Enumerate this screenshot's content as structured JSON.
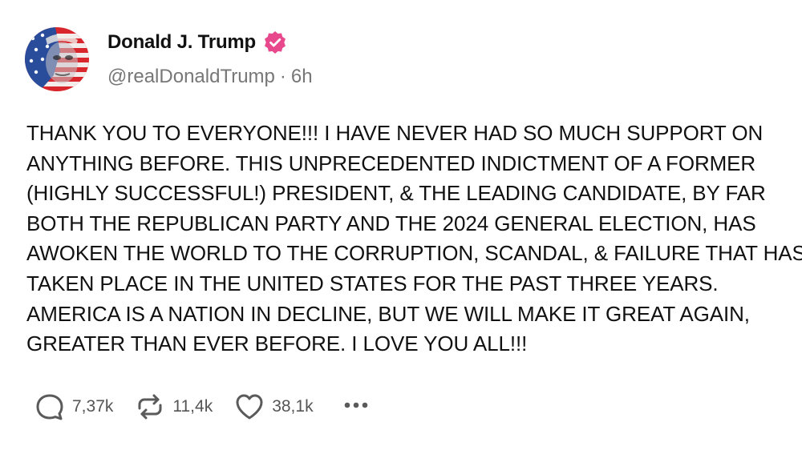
{
  "post": {
    "author": {
      "display_name": "Donald J. Trump",
      "verified": true,
      "handle": "@realDonaldTrump",
      "separator": "·",
      "time": "6h"
    },
    "text": "THANK YOU TO EVERYONE!!! I HAVE NEVER HAD SO MUCH SUPPORT ON\nANYTHING BEFORE. THIS UNPRECEDENTED INDICTMENT OF A FORMER\n(HIGHLY SUCCESSFUL!) PRESIDENT, & THE LEADING CANDIDATE, BY FAR\nBOTH THE REPUBLICAN PARTY AND THE 2024 GENERAL ELECTION, HAS\nAWOKEN THE WORLD TO THE CORRUPTION, SCANDAL, & FAILURE THAT HAS\nTAKEN PLACE IN THE UNITED STATES FOR THE PAST THREE YEARS.\nAMERICA IS A NATION IN DECLINE, BUT WE WILL MAKE IT GREAT AGAIN,\nGREATER THAN EVER BEFORE. I LOVE YOU ALL!!!",
    "actions": {
      "replies": "7,37k",
      "reposts": "11,4k",
      "likes": "38,1k"
    }
  },
  "icons": {
    "reply": "speech-bubble-icon",
    "repost": "repost-arrows-icon",
    "like": "heart-icon",
    "more": "more-dots-icon",
    "verified": "verified-badge-icon"
  },
  "colors": {
    "verified_badge": "#e8498c",
    "handle_gray": "#777777",
    "count_gray": "#555555",
    "icon_gray": "#5a5a5a"
  }
}
